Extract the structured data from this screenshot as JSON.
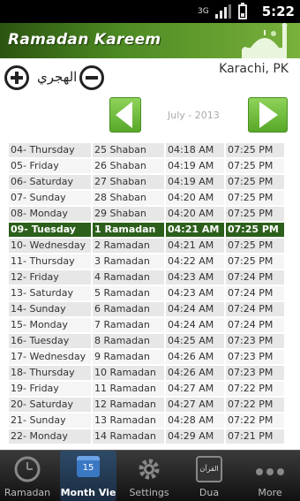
{
  "status_bar": {
    "data_label": "3G",
    "time": "5:22"
  },
  "header": {
    "title": "Ramadan Kareem"
  },
  "controls": {
    "hijri_label": "الهجري",
    "location": "Karachi, PK"
  },
  "nav": {
    "month": "July - 2013"
  },
  "table": {
    "rows": [
      {
        "day": "04- Thursday",
        "hijri": "25 Shaban",
        "sehri": "04:18 AM",
        "iftar": "07:25 PM"
      },
      {
        "day": "05- Friday",
        "hijri": "26 Shaban",
        "sehri": "04:19 AM",
        "iftar": "07:25 PM"
      },
      {
        "day": "06- Saturday",
        "hijri": "27 Shaban",
        "sehri": "04:19 AM",
        "iftar": "07:25 PM"
      },
      {
        "day": "07- Sunday",
        "hijri": "28 Shaban",
        "sehri": "04:20 AM",
        "iftar": "07:25 PM"
      },
      {
        "day": "08- Monday",
        "hijri": "29 Shaban",
        "sehri": "04:20 AM",
        "iftar": "07:25 PM"
      },
      {
        "day": "09- Tuesday",
        "hijri": "1 Ramadan",
        "sehri": "04:21 AM",
        "iftar": "07:25 PM"
      },
      {
        "day": "10- Wednesday",
        "hijri": "2 Ramadan",
        "sehri": "04:21 AM",
        "iftar": "07:25 PM"
      },
      {
        "day": "11- Thursday",
        "hijri": "3 Ramadan",
        "sehri": "04:22 AM",
        "iftar": "07:25 PM"
      },
      {
        "day": "12- Friday",
        "hijri": "4 Ramadan",
        "sehri": "04:23 AM",
        "iftar": "07:24 PM"
      },
      {
        "day": "13- Saturday",
        "hijri": "5 Ramadan",
        "sehri": "04:23 AM",
        "iftar": "07:24 PM"
      },
      {
        "day": "14- Sunday",
        "hijri": "6 Ramadan",
        "sehri": "04:24 AM",
        "iftar": "07:24 PM"
      },
      {
        "day": "15- Monday",
        "hijri": "7 Ramadan",
        "sehri": "04:24 AM",
        "iftar": "07:24 PM"
      },
      {
        "day": "16- Tuesday",
        "hijri": "8 Ramadan",
        "sehri": "04:25 AM",
        "iftar": "07:23 PM"
      },
      {
        "day": "17- Wednesday",
        "hijri": "9 Ramadan",
        "sehri": "04:26 AM",
        "iftar": "07:23 PM"
      },
      {
        "day": "18- Thursday",
        "hijri": "10 Ramadan",
        "sehri": "04:26 AM",
        "iftar": "07:23 PM"
      },
      {
        "day": "19- Friday",
        "hijri": "11 Ramadan",
        "sehri": "04:27 AM",
        "iftar": "07:22 PM"
      },
      {
        "day": "20- Saturday",
        "hijri": "12 Ramadan",
        "sehri": "04:27 AM",
        "iftar": "07:22 PM"
      },
      {
        "day": "21- Sunday",
        "hijri": "13 Ramadan",
        "sehri": "04:28 AM",
        "iftar": "07:22 PM"
      },
      {
        "day": "22- Monday",
        "hijri": "14 Ramadan",
        "sehri": "04:29 AM",
        "iftar": "07:21 PM"
      }
    ]
  },
  "tabs": [
    {
      "label": "Ramadan",
      "icon": "clock-icon"
    },
    {
      "label": "Month Vie",
      "icon": "calendar-icon",
      "badge": "15"
    },
    {
      "label": "Settings",
      "icon": "gear-icon"
    },
    {
      "label": "Dua",
      "icon": "quran-icon",
      "glyph": "القرآن"
    },
    {
      "label": "More",
      "icon": "more-dots-icon"
    }
  ]
}
